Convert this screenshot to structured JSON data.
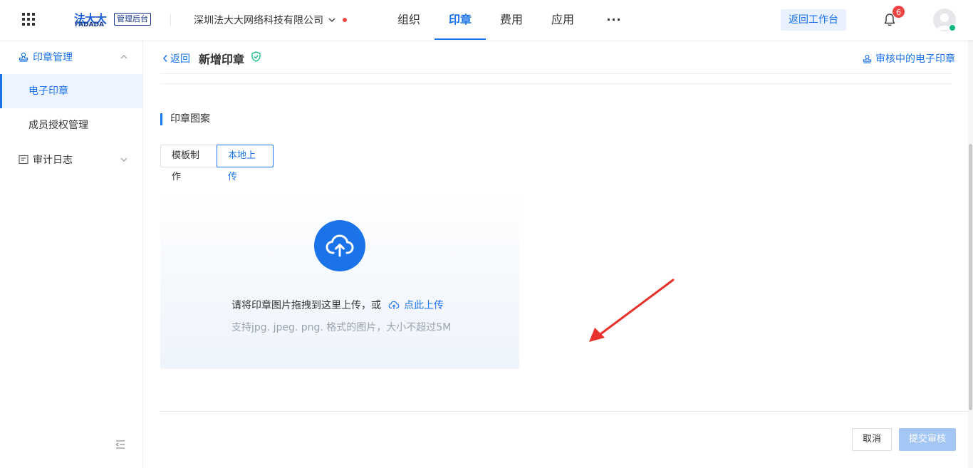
{
  "header": {
    "logo_cn": "法大大",
    "logo_en": "FADADA",
    "admin_badge": "管理后台",
    "company": "深圳法大大网络科技有限公司",
    "nav": [
      {
        "label": "组织"
      },
      {
        "label": "印章"
      },
      {
        "label": "费用"
      },
      {
        "label": "应用"
      },
      {
        "label": "···"
      }
    ],
    "back_to_workspace": "返回工作台",
    "notification_count": "6"
  },
  "sidebar": {
    "groups": [
      {
        "label": "印章管理",
        "icon": "stamp-icon",
        "expanded": true
      },
      {
        "label": "审计日志",
        "icon": "log-icon",
        "expanded": false
      }
    ],
    "items": [
      {
        "label": "电子印章",
        "active": true
      },
      {
        "label": "成员授权管理",
        "active": false
      }
    ]
  },
  "main": {
    "back_label": "返回",
    "title": "新增印章",
    "review_link": "审核中的电子印章",
    "section_title": "印章图案",
    "tabs": [
      {
        "label": "模板制作",
        "active": false
      },
      {
        "label": "本地上传",
        "active": true
      }
    ],
    "upload": {
      "hint": "请将印章图片拖拽到这里上传，或",
      "link": "点此上传",
      "sub": "支持jpg. jpeg. png. 格式的图片，大小不超过5M"
    },
    "buttons": {
      "cancel": "取消",
      "submit": "提交审核"
    }
  },
  "colors": {
    "accent": "#1a73e8",
    "badge": "#ef4444",
    "submit_disabled": "#a3c6f4",
    "annotation_arrow": "#e8312a"
  }
}
